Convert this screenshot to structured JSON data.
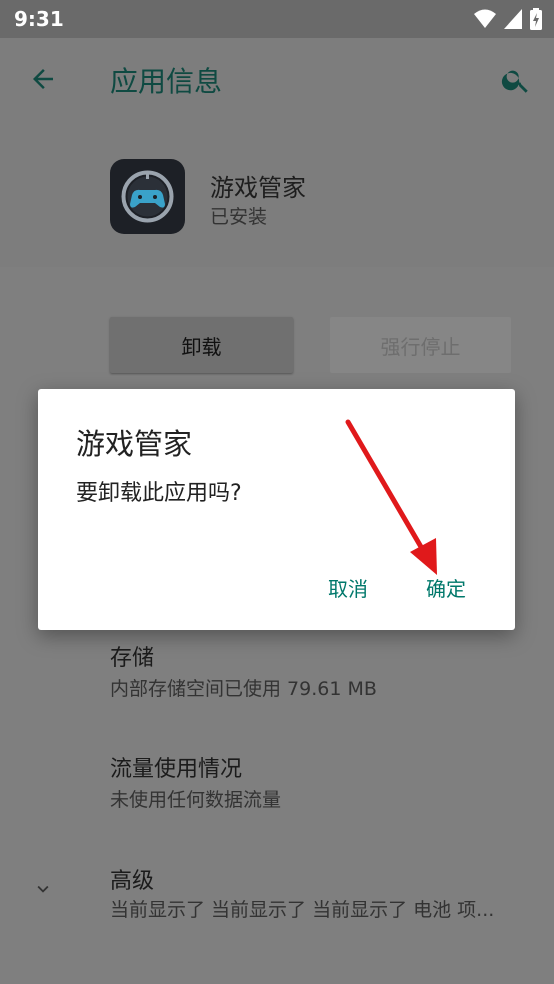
{
  "status_bar": {
    "time": "9:31"
  },
  "app_bar": {
    "title": "应用信息"
  },
  "app": {
    "name": "游戏管家",
    "status": "已安装"
  },
  "buttons": {
    "uninstall": "卸载",
    "force_stop": "强行停止"
  },
  "rows": [
    {
      "title": "存储",
      "subtitle": "内部存储空间已使用 79.61 MB"
    },
    {
      "title": "流量使用情况",
      "subtitle": "未使用任何数据流量"
    },
    {
      "title": "高级",
      "subtitle": "当前显示了 当前显示了 当前显示了 电池 项..."
    }
  ],
  "dialog": {
    "title": "游戏管家",
    "message": "要卸载此应用吗?",
    "cancel": "取消",
    "ok": "确定"
  },
  "colors": {
    "accent": "#00786b",
    "scrim": "#7d7d7d",
    "annotation_arrow": "#e0191b"
  }
}
